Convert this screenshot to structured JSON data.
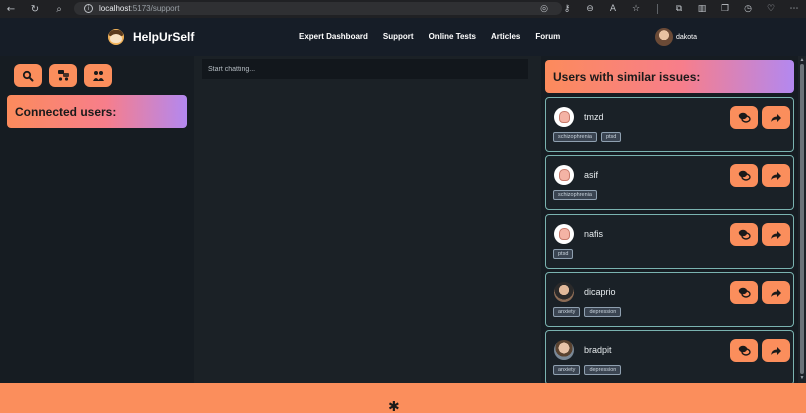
{
  "browser": {
    "url_host": "localhost",
    "url_path": ":5173/support",
    "icons": [
      "back-icon",
      "reload-icon",
      "search-icon",
      "info-icon",
      "location-icon",
      "key-icon",
      "zoom-icon",
      "read-aloud-icon",
      "favorite-icon",
      "extensions-icon",
      "split-screen-icon",
      "collections-icon",
      "history-icon",
      "performance-icon",
      "more-icon"
    ]
  },
  "navbar": {
    "brand": "HelpUrSelf",
    "links": [
      "Expert Dashboard",
      "Support",
      "Online Tests",
      "Articles",
      "Forum"
    ],
    "username": "dakota"
  },
  "left_panel": {
    "tools": [
      "search-icon",
      "group-chat-icon",
      "people-icon"
    ],
    "connected_title": "Connected users:"
  },
  "chat": {
    "placeholder": "Start chatting..."
  },
  "right_panel": {
    "title": "Users with similar issues:",
    "users": [
      {
        "name": "tmzd",
        "avatar": "default",
        "tags": [
          "schizophrenia",
          "ptsd"
        ]
      },
      {
        "name": "asif",
        "avatar": "default",
        "tags": [
          "schizophrenia"
        ]
      },
      {
        "name": "nafis",
        "avatar": "default",
        "tags": [
          "ptsd"
        ]
      },
      {
        "name": "dicaprio",
        "avatar": "photo",
        "tags": [
          "anxiety",
          "depression"
        ]
      },
      {
        "name": "bradpit",
        "avatar": "photo",
        "tags": [
          "anxiety",
          "depression"
        ]
      }
    ]
  },
  "colors": {
    "accent": "#fb8e5c",
    "gradient_end": "#b388f0",
    "background": "#1b2126"
  }
}
